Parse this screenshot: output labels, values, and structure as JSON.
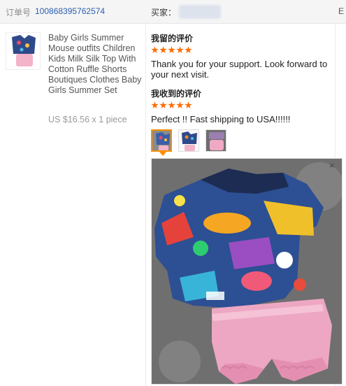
{
  "header": {
    "order_label": "订单号",
    "order_number": "100868395762574",
    "buyer_label": "买家：",
    "right_fragment": "E"
  },
  "product": {
    "title": "Baby Girls Summer Mouse outfits Children Kids Milk Silk Top With Cotton Ruffle Shorts Boutiques Clothes Baby Girls Summer Set",
    "price": "US $16.56 x 1 piece",
    "thumbnail_icon": "product-thumbnail-icon"
  },
  "my_review": {
    "title": "我留的评价",
    "stars": 5,
    "text": "Thank you for your support. Look forward to your next visit."
  },
  "received_review": {
    "title": "我收到的评价",
    "stars": 5,
    "text": "Perfect !! Fast shipping to USA!!!!!!"
  },
  "preview": {
    "close_label": "×"
  },
  "colors": {
    "accent": "#ff6a00",
    "active_border": "#ff9000",
    "link": "#2a5db0"
  }
}
